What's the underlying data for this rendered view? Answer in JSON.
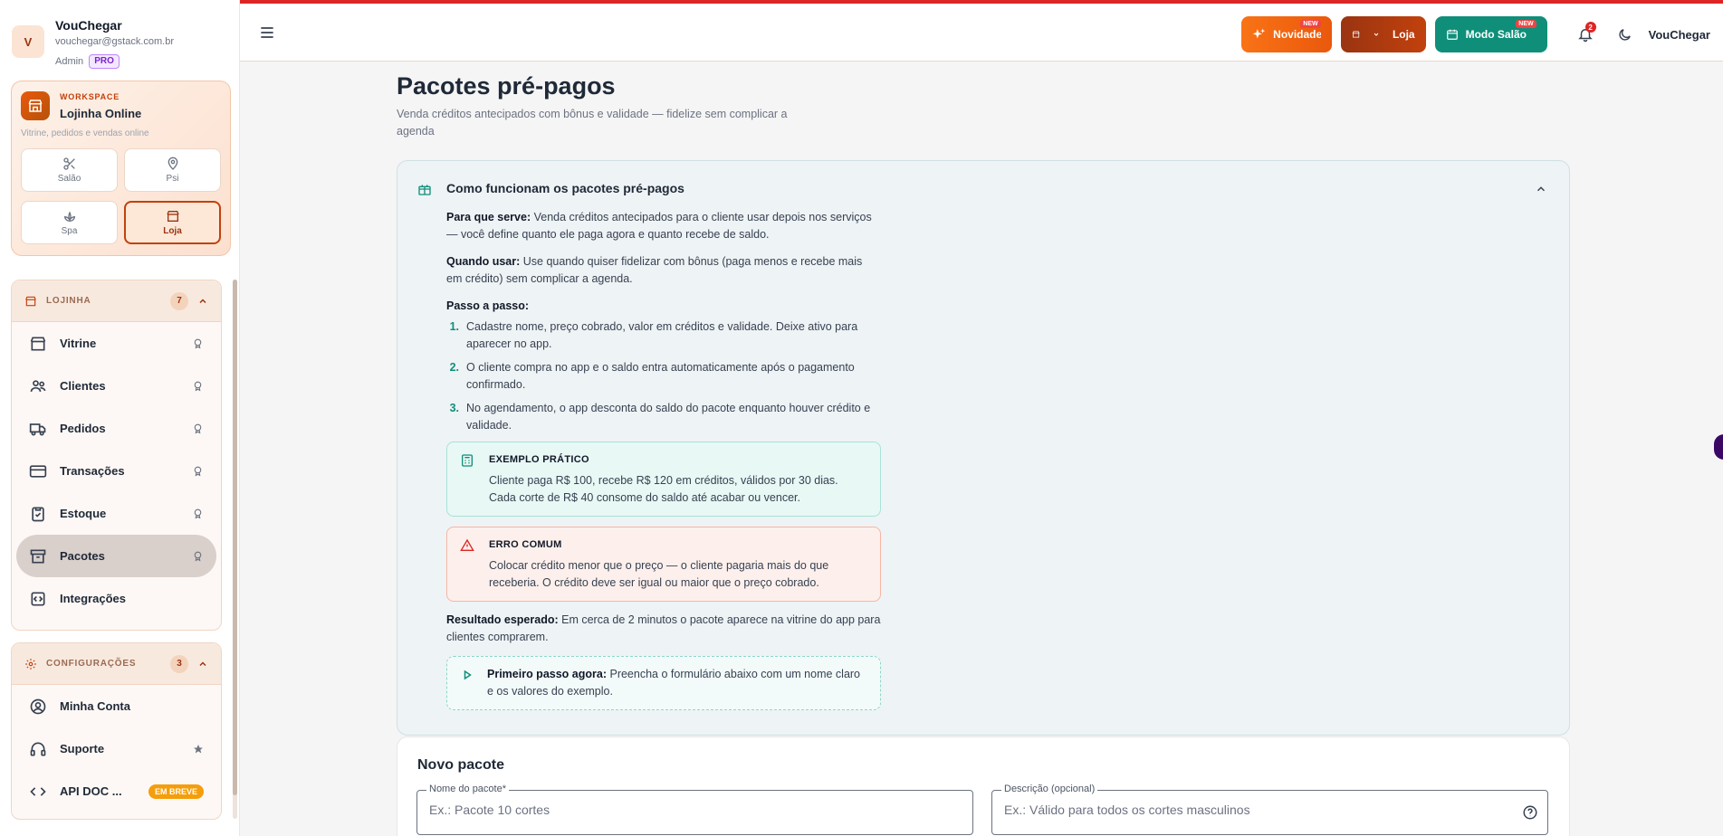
{
  "user": {
    "initial": "V",
    "name": "VouChegar",
    "email": "vouchegar@gstack.com.br",
    "role": "Admin",
    "plan": "PRO"
  },
  "workspace": {
    "label": "WORKSPACE",
    "title": "Lojinha Online",
    "subtitle": "Vitrine, pedidos e vendas online",
    "tiles": [
      {
        "label": "Salão",
        "icon": "scissors-icon"
      },
      {
        "label": "Psi",
        "icon": "map-pin-icon"
      },
      {
        "label": "Spa",
        "icon": "lotus-icon"
      },
      {
        "label": "Loja",
        "icon": "store-icon",
        "active": true
      }
    ]
  },
  "nav": {
    "lojinha": {
      "title": "LOJINHA",
      "count": "7",
      "items": [
        {
          "label": "Vitrine",
          "icon": "storefront-icon"
        },
        {
          "label": "Clientes",
          "icon": "users-icon"
        },
        {
          "label": "Pedidos",
          "icon": "truck-icon"
        },
        {
          "label": "Transações",
          "icon": "credit-card-icon"
        },
        {
          "label": "Estoque",
          "icon": "clipboard-check-icon"
        },
        {
          "label": "Pacotes",
          "icon": "archive-box-icon",
          "active": true
        },
        {
          "label": "Integrações",
          "icon": "code-square-icon"
        }
      ]
    },
    "config": {
      "title": "CONFIGURAÇÕES",
      "count": "3",
      "items": [
        {
          "label": "Minha Conta",
          "icon": "user-circle-icon"
        },
        {
          "label": "Suporte",
          "icon": "headset-icon"
        },
        {
          "label": "API DOC ...",
          "icon": "code-icon",
          "badge": "EM BREVE"
        }
      ]
    }
  },
  "topbar": {
    "news_label": "Novidades",
    "store_label": "Loja",
    "salon_label": "Modo Salão",
    "new_tag": "NEW",
    "notifications": "2",
    "user_name": "VouChegar"
  },
  "page": {
    "title": "Pacotes pré-pagos",
    "subtitle": "Venda créditos antecipados com bônus e validade — fidelize sem complicar a agenda"
  },
  "help": {
    "title": "Como funcionam os pacotes pré-pagos",
    "purpose_label": "Para que serve:",
    "purpose_text": "Venda créditos antecipados para o cliente usar depois nos serviços — você define quanto ele paga agora e quanto recebe de saldo.",
    "when_label": "Quando usar:",
    "when_text": "Use quando quiser fidelizar com bônus (paga menos e recebe mais em crédito) sem complicar a agenda.",
    "steps_label": "Passo a passo:",
    "steps": [
      {
        "num": "1.",
        "text": "Cadastre nome, preço cobrado, valor em créditos e validade. Deixe ativo para aparecer no app."
      },
      {
        "num": "2.",
        "text": "O cliente compra no app e o saldo entra automaticamente após o pagamento confirmado."
      },
      {
        "num": "3.",
        "text": "No agendamento, o app desconta do saldo do pacote enquanto houver crédito e validade."
      }
    ],
    "example_title": "EXEMPLO PRÁTICO",
    "example_text": "Cliente paga R$ 100, recebe R$ 120 em créditos, válidos por 30 dias. Cada corte de R$ 40 consome do saldo até acabar ou vencer.",
    "error_title": "ERRO COMUM",
    "error_text": "Colocar crédito menor que o preço — o cliente pagaria mais do que receberia. O crédito deve ser igual ou maior que o preço cobrado.",
    "result_label": "Resultado esperado:",
    "result_text": "Em cerca de 2 minutos o pacote aparece na vitrine do app para clientes comprarem.",
    "first_label": "Primeiro passo agora:",
    "first_text": "Preencha o formulário abaixo com um nome claro e os valores do exemplo."
  },
  "form": {
    "title": "Novo pacote",
    "name_label": "Nome do pacote*",
    "name_placeholder": "Ex.: Pacote 10 cortes",
    "desc_label": "Descrição (opcional)",
    "desc_placeholder": "Ex.: Válido para todos os cortes masculinos"
  },
  "colors": {
    "accent": "#c2410c",
    "teal": "#0f8f7a",
    "topline": "#dc2626"
  }
}
